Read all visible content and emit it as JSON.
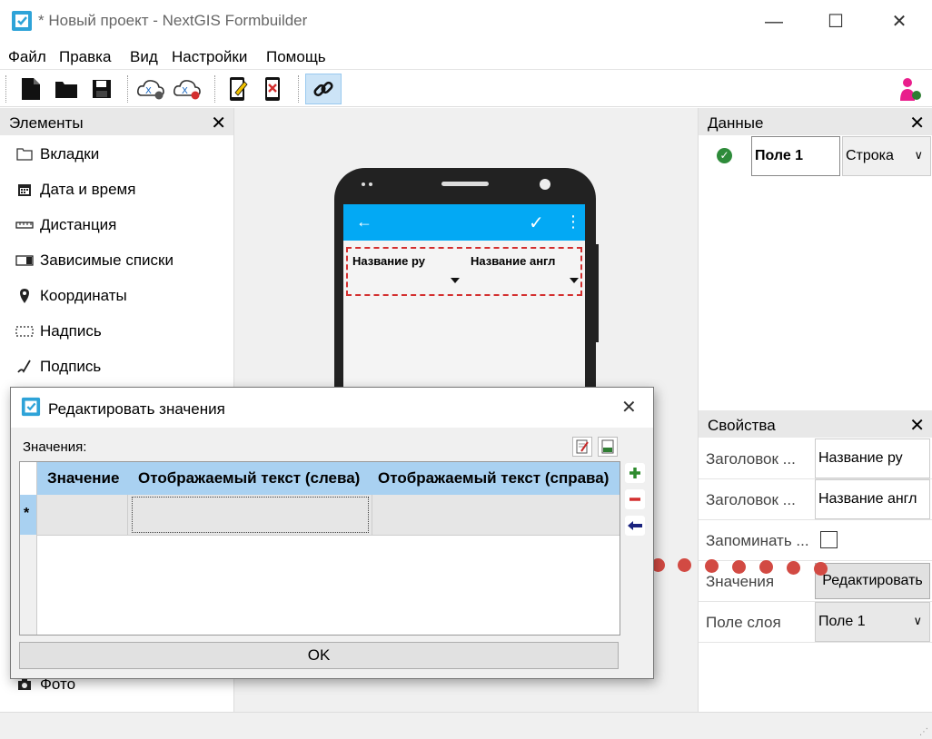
{
  "window": {
    "title": "* Новый проект - NextGIS Formbuilder",
    "min": "—",
    "max": "☐",
    "close": "✕"
  },
  "menu": [
    "Файл",
    "Правка",
    "Вид",
    "Настройки",
    "Помощь"
  ],
  "elements_panel": {
    "title": "Элементы",
    "items": [
      "Вкладки",
      "Дата и время",
      "Дистанция",
      "Зависимые списки",
      "Координаты",
      "Надпись",
      "Подпись",
      "Фото"
    ]
  },
  "phone": {
    "back": "←",
    "check": "✓",
    "more": "⋮",
    "label_ru": "Название ру",
    "label_en": "Название англ"
  },
  "data_panel": {
    "title": "Данные",
    "field": "Поле 1",
    "type": "Строка"
  },
  "props_panel": {
    "title": "Свойства",
    "rows": [
      {
        "label": "Заголовок ...",
        "value": "Название ру"
      },
      {
        "label": "Заголовок ...",
        "value": "Название англ"
      },
      {
        "label": "Запоминать ...",
        "value": ""
      },
      {
        "label": "Значения",
        "value": "Редактировать"
      },
      {
        "label": "Поле слоя",
        "value": "Поле 1"
      }
    ]
  },
  "dialog": {
    "title": "Редактировать значения",
    "values_label": "Значения:",
    "columns": [
      "Значение",
      "Отображаемый текст (слева)",
      "Отображаемый текст (справа)"
    ],
    "new_row_marker": "*",
    "ok": "OK",
    "close": "✕"
  },
  "colors": {
    "accent": "#03a9f4",
    "dashed": "#d32f2f",
    "grid_header": "#a9d1f1",
    "dots": "#d24a43"
  }
}
